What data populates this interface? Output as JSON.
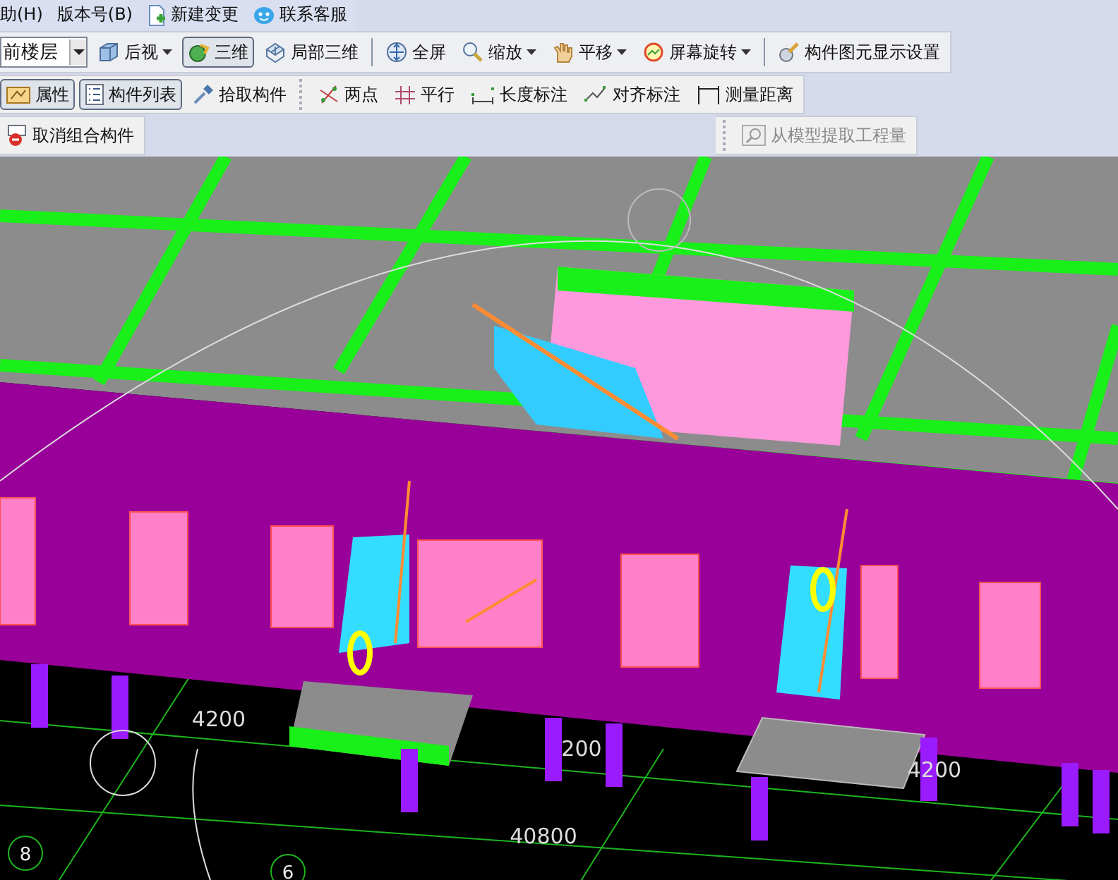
{
  "menu_bar": [
    {
      "label": "助(H)"
    },
    {
      "label": "版本号(B)"
    },
    {
      "label": "新建变更"
    },
    {
      "label": "联系客服"
    }
  ],
  "toolbar_rows": [
    {
      "items": [
        {
          "kind": "combo",
          "label": "前楼层"
        },
        {
          "kind": "button",
          "label": "后视",
          "pressed": false,
          "caret": true
        },
        {
          "kind": "button",
          "label": "三维",
          "pressed": true,
          "caret": false
        },
        {
          "kind": "button",
          "label": "局部三维",
          "pressed": false,
          "caret": false
        },
        {
          "kind": "separator"
        },
        {
          "kind": "button",
          "label": "全屏",
          "pressed": false,
          "caret": false
        },
        {
          "kind": "button",
          "label": "缩放",
          "pressed": false,
          "caret": true
        },
        {
          "kind": "button",
          "label": "平移",
          "pressed": false,
          "caret": true
        },
        {
          "kind": "button",
          "label": "屏幕旋转",
          "pressed": false,
          "caret": true
        },
        {
          "kind": "separator"
        },
        {
          "kind": "button",
          "label": "构件图元显示设置",
          "pressed": false,
          "caret": false
        }
      ]
    },
    {
      "items": [
        {
          "kind": "button",
          "label": "属性",
          "pressed": true,
          "caret": false
        },
        {
          "kind": "button",
          "label": "构件列表",
          "pressed": true,
          "caret": false
        },
        {
          "kind": "button",
          "label": "拾取构件",
          "pressed": false,
          "caret": false
        },
        {
          "kind": "grip"
        },
        {
          "kind": "button",
          "label": "两点",
          "pressed": false,
          "caret": false
        },
        {
          "kind": "button",
          "label": "平行",
          "pressed": false,
          "caret": false
        },
        {
          "kind": "button",
          "label": "长度标注",
          "pressed": false,
          "caret": false
        },
        {
          "kind": "button",
          "label": "对齐标注",
          "pressed": false,
          "caret": false
        },
        {
          "kind": "button",
          "label": "测量距离",
          "pressed": false,
          "caret": false
        }
      ]
    },
    {
      "items": [
        {
          "kind": "button",
          "label": "取消组合构件",
          "pressed": false,
          "caret": false
        },
        {
          "kind": "gap"
        },
        {
          "kind": "grip"
        },
        {
          "kind": "button",
          "label": "从模型提取工程量",
          "pressed": false,
          "caret": false,
          "disabled": true
        }
      ]
    }
  ],
  "viewport": {
    "labels": [
      {
        "kind": "dimension",
        "text": "4200"
      },
      {
        "kind": "dimension",
        "text": "200"
      },
      {
        "kind": "dimension",
        "text": "4200"
      },
      {
        "kind": "dimension",
        "text": "40800"
      },
      {
        "kind": "axis",
        "text": "8"
      },
      {
        "kind": "axis",
        "text": "6"
      }
    ]
  }
}
